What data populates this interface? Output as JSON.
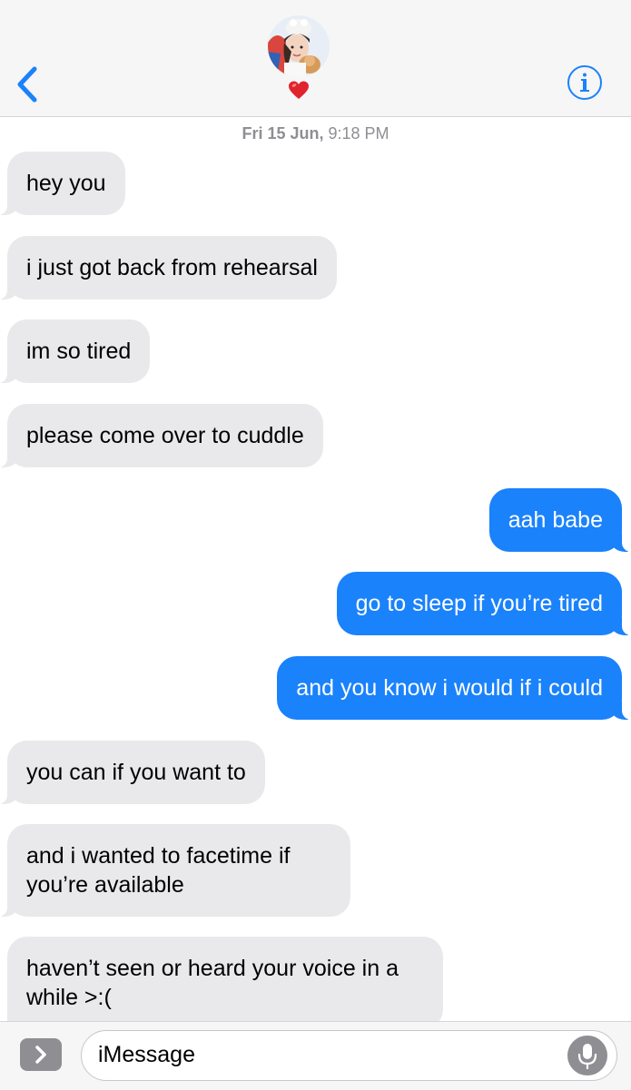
{
  "header": {
    "back_icon": "chevron-left-icon",
    "contact_heart": "❤️",
    "info_icon": "info-icon"
  },
  "timestamp": {
    "day": "Fri 15 Jun,",
    "time": "9:18 PM"
  },
  "messages": [
    {
      "direction": "in",
      "text": "hey you"
    },
    {
      "direction": "in",
      "text": "i just got back from rehearsal"
    },
    {
      "direction": "in",
      "text": "im so tired"
    },
    {
      "direction": "in",
      "text": "please come over to cuddle"
    },
    {
      "direction": "out",
      "text": "aah babe"
    },
    {
      "direction": "out",
      "text": "go to sleep if you’re tired"
    },
    {
      "direction": "out",
      "text": "and you know i would if i could"
    },
    {
      "direction": "in",
      "text": "you can if you want to"
    },
    {
      "direction": "in",
      "text": "and i wanted to facetime if you’re available"
    },
    {
      "direction": "in",
      "text": "haven’t seen or heard your voice in a while >:("
    }
  ],
  "input": {
    "placeholder": "iMessage",
    "apps_icon": "chevron-right-icon",
    "mic_icon": "microphone-icon"
  },
  "colors": {
    "incoming_bubble": "#e9e9eb",
    "outgoing_bubble": "#1a82fb",
    "accent": "#1a82fb"
  }
}
